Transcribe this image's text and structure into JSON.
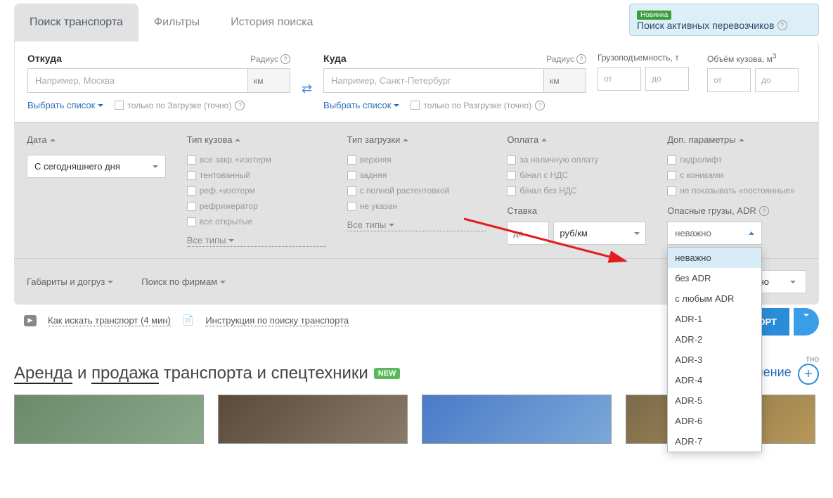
{
  "tabs": {
    "search": "Поиск транспорта",
    "filters": "Фильтры",
    "history": "История поиска"
  },
  "promo": {
    "badge": "Новинка",
    "text": "Поиск активных перевозчиков"
  },
  "from": {
    "label": "Откуда",
    "radius_label": "Радиус",
    "placeholder": "Например, Москва",
    "km": "км",
    "select_list": "Выбрать список",
    "checkbox": "только по Загрузке (точно)"
  },
  "to": {
    "label": "Куда",
    "radius_label": "Радиус",
    "placeholder": "Например, Санкт-Петербург",
    "km": "км",
    "select_list": "Выбрать список",
    "checkbox": "только по Разгрузке (точно)"
  },
  "capacity": {
    "label": "Грузоподъемность, т",
    "from": "от",
    "to": "до"
  },
  "volume": {
    "label_prefix": "Объём кузова, м",
    "label_sup": "3",
    "from": "от",
    "to": "до"
  },
  "date": {
    "header": "Дата",
    "value": "С сегодняшнего дня"
  },
  "body_type": {
    "header": "Тип кузова",
    "items": [
      "все закр.+изотерм",
      "тентованный",
      "реф.+изотерм",
      "рефрижератор",
      "все открытые"
    ],
    "all": "Все типы"
  },
  "loading_type": {
    "header": "Тип загрузки",
    "items": [
      "верхняя",
      "задняя",
      "с полной растентовкой",
      "не указан"
    ],
    "all": "Все типы"
  },
  "payment": {
    "header": "Оплата",
    "items": [
      "за наличную оплату",
      "б/нал с НДС",
      "б/нал без НДС"
    ],
    "rate_label": "Ставка",
    "rate_to": "до",
    "rate_unit": "руб/км"
  },
  "extra": {
    "header": "Доп. параметры",
    "items": [
      "гидролифт",
      "с кониками",
      "не показывать «постоянные»"
    ],
    "adr_label": "Опасные грузы, ADR",
    "adr_value": "неважно",
    "adr_options": [
      "неважно",
      "без ADR",
      "с любым ADR",
      "ADR-1",
      "ADR-2",
      "ADR-3",
      "ADR-4",
      "ADR-5",
      "ADR-6",
      "ADR-7"
    ]
  },
  "row3": {
    "gabarity": "Габариты и догруз",
    "firms": "Поиск по фирмам",
    "do": "До",
    "dno": "дно"
  },
  "help_links": {
    "video": "Как искать транспорт (4 мин)",
    "doc": "Инструкция по поиску транспорта"
  },
  "button": {
    "search": "РАНСПОРТ"
  },
  "bottom": {
    "rent": "Аренда",
    "and": " и ",
    "sale": "продажа",
    "rest": " транспорта и спецтехники",
    "new": "NEW",
    "free": "тно",
    "place_ad": "вить объявление"
  }
}
